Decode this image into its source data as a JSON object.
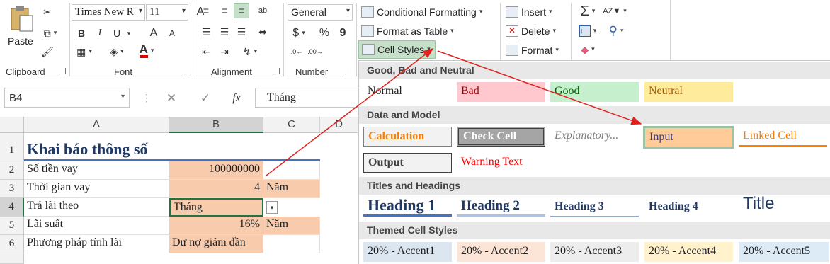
{
  "ribbon": {
    "clipboard": {
      "paste_label": "Paste",
      "group_label": "Clipboard"
    },
    "font": {
      "font_name": "Times New R",
      "font_size": "11",
      "group_label": "Font",
      "bold": "B",
      "italic": "I",
      "underline": "U",
      "grow": "A",
      "shrink": "A",
      "font_color": "A"
    },
    "alignment": {
      "group_label": "Alignment",
      "wrap": "ab"
    },
    "number": {
      "format": "General",
      "group_label": "Number",
      "currency": "$",
      "percent": "%",
      "comma": "9"
    },
    "styles": {
      "conditional": "Conditional Formatting",
      "format_table": "Format as Table",
      "cell_styles": "Cell Styles"
    },
    "cells": {
      "insert": "Insert",
      "delete": "Delete",
      "format": "Format"
    },
    "editing": {
      "sum": "Σ",
      "sort": "Z"
    }
  },
  "formula_bar": {
    "name_box": "B4",
    "formula": "Tháng",
    "fx": "fx"
  },
  "sheet": {
    "columns": [
      "A",
      "B",
      "C",
      "D"
    ],
    "rows": [
      "1",
      "2",
      "3",
      "4",
      "5",
      "6"
    ],
    "a1": "Khai báo thông số",
    "a2": "Số tiền vay",
    "b2": "100000000",
    "a3": "Thời gian vay",
    "b3": "4",
    "c3": "Năm",
    "a4": "Trả lãi theo",
    "b4": "Tháng",
    "a5": "Lãi suất",
    "b5": "16%",
    "c5": "Năm",
    "a6": "Phương pháp tính lãi",
    "b6": "Dư nợ giảm dần"
  },
  "gallery": {
    "good_bad_neutral": {
      "title": "Good, Bad and Neutral",
      "normal": "Normal",
      "bad": "Bad",
      "good": "Good",
      "neutral": "Neutral"
    },
    "data_model": {
      "title": "Data and Model",
      "calculation": "Calculation",
      "check_cell": "Check Cell",
      "explanatory": "Explanatory...",
      "input": "Input",
      "linked_cell": "Linked Cell",
      "output": "Output",
      "warning": "Warning Text"
    },
    "titles": {
      "title": "Titles and Headings",
      "h1": "Heading 1",
      "h2": "Heading 2",
      "h3": "Heading 3",
      "h4": "Heading 4",
      "title_style": "Title"
    },
    "themed": {
      "title": "Themed Cell Styles",
      "a1": "20% - Accent1",
      "a2": "20% - Accent2",
      "a3": "20% - Accent3",
      "a4": "20% - Accent4",
      "a5": "20% - Accent5"
    }
  },
  "colors": {
    "input_orange": "#f8cbad",
    "arrow_red": "#e0201c",
    "accent1": "#dce6f1",
    "accent2": "#fce4d6",
    "accent3": "#ededed",
    "accent4": "#fff2cc",
    "accent5": "#ddebf7"
  }
}
